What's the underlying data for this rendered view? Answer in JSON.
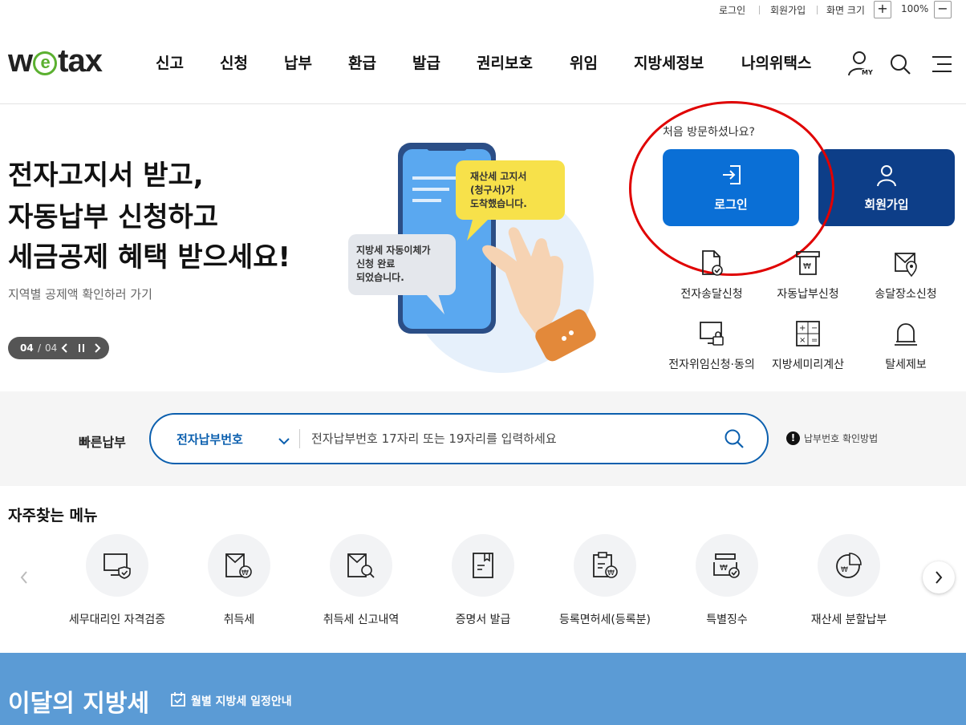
{
  "util": {
    "login": "로그인",
    "signup": "회원가입",
    "zoom_label": "화면 크기",
    "zoom_in": "+",
    "zoom_value": "100%",
    "zoom_out": "−"
  },
  "header": {
    "logo_pre": "w",
    "logo_e": "e",
    "logo_post": "tax",
    "nav": [
      "신고",
      "신청",
      "납부",
      "환급",
      "발급",
      "권리보호",
      "위임",
      "지방세정보",
      "나의위택스"
    ],
    "my_label": "MY"
  },
  "hero": {
    "line1": "전자고지서 받고,",
    "line2": "자동납부 신청하고",
    "line3": "세금공제 혜택 받으세요!",
    "sub": "지역별 공제액 확인하러 가기",
    "pager_current": "04",
    "pager_sep": "/",
    "pager_total": "04",
    "bubble1_l1": "재산세 고지서",
    "bubble1_l2": "(청구서)가",
    "bubble1_l3": "도착했습니다.",
    "bubble2_l1": "지방세 자동이체가",
    "bubble2_l2": "신청 완료",
    "bubble2_l3": "되었습니다."
  },
  "panel": {
    "first_visit": "처음 방문하셨나요?",
    "login_btn": "로그인",
    "signup_btn": "회원가입",
    "items": [
      {
        "label": "전자송달신청",
        "icon": "document-check-icon"
      },
      {
        "label": "자동납부신청",
        "icon": "auto-pay-icon"
      },
      {
        "label": "송달장소신청",
        "icon": "location-mail-icon"
      },
      {
        "label": "전자위임신청·동의",
        "icon": "monitor-lock-icon"
      },
      {
        "label": "지방세미리계산",
        "icon": "calculator-icon"
      },
      {
        "label": "탈세제보",
        "icon": "siren-icon"
      }
    ]
  },
  "quickpay": {
    "title": "빠른납부",
    "select_value": "전자납부번호",
    "placeholder": "전자납부번호 17자리 또는 19자리를 입력하세요",
    "help": "납부번호 확인방법"
  },
  "frequent": {
    "title": "자주찾는 메뉴",
    "items": [
      {
        "label": "세무대리인 자격검증",
        "icon": "monitor-shield-icon"
      },
      {
        "label": "취득세",
        "icon": "acquisition-tax-icon"
      },
      {
        "label": "취득세 신고내역",
        "icon": "tax-search-icon"
      },
      {
        "label": "증명서 발급",
        "icon": "certificate-icon"
      },
      {
        "label": "등록면허세(등록분)",
        "icon": "registration-tax-icon"
      },
      {
        "label": "특별징수",
        "icon": "special-collection-icon"
      },
      {
        "label": "재산세 분할납부",
        "icon": "pie-chart-icon"
      }
    ]
  },
  "monthly": {
    "title": "이달의 지방세",
    "link": "월별 지방세 일정안내"
  },
  "colors": {
    "primary": "#0b5fae",
    "login_btn": "#0a6fd6",
    "signup_btn": "#0d3e88",
    "monthly_bg": "#5b9bd5",
    "logo_green": "#5bb030",
    "annotation_red": "#e00000"
  }
}
